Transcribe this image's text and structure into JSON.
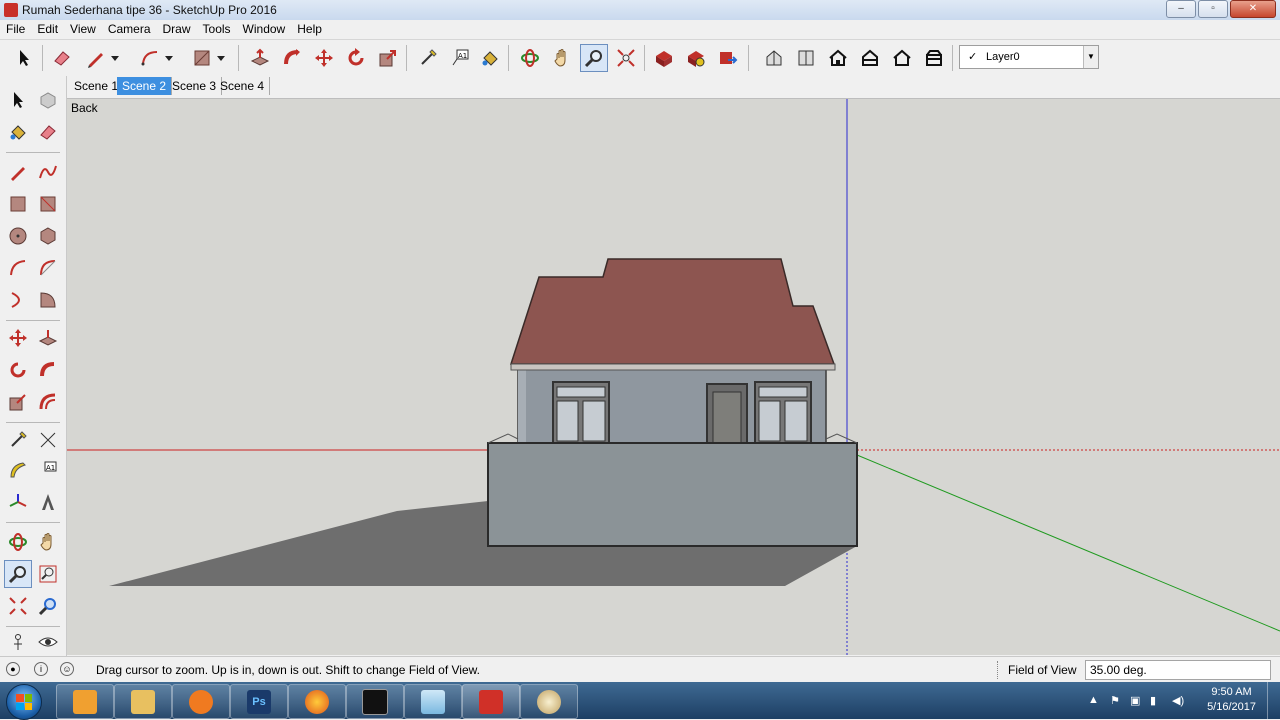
{
  "window": {
    "title": "Rumah Sederhana tipe 36 - SketchUp Pro 2016",
    "controls": {
      "minimize": "–",
      "maximize": "▫",
      "close": "✕"
    }
  },
  "menu": [
    "File",
    "Edit",
    "View",
    "Camera",
    "Draw",
    "Tools",
    "Window",
    "Help"
  ],
  "toolbar": {
    "layer": {
      "check": "✓",
      "selected": "Layer0",
      "dropdown": "▼"
    }
  },
  "scenes": {
    "tabs": [
      "Scene 1",
      "Scene 2",
      "Scene 3",
      "Scene 4"
    ],
    "active_index": 1
  },
  "viewport": {
    "view_label": "Back"
  },
  "status": {
    "message": "Drag cursor to zoom.  Up is in, down is out. Shift to change Field of View.",
    "measure_label": "Field of View",
    "measure_value": "35.00 deg."
  },
  "taskbar": {
    "time": "9:50 AM",
    "date": "5/16/2017",
    "tray_arrow": "▲"
  },
  "colors": {
    "roof": "#8d5550",
    "wall": "#8f979f",
    "fence": "#8b9397",
    "shadow": "#6e6e6e",
    "axis_red": "#cc2020",
    "axis_green": "#1f9a1f",
    "axis_blue": "#2a2ad0",
    "active_tab": "#3d8fe0"
  }
}
